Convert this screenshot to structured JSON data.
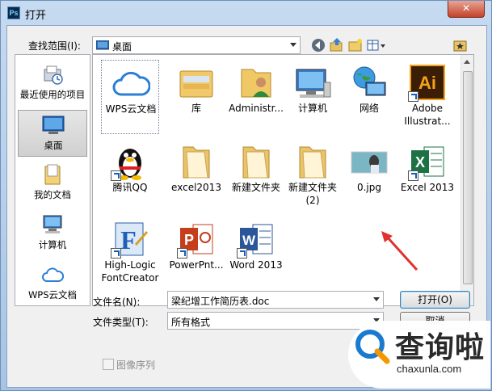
{
  "window": {
    "app_icon_text": "Ps",
    "title": "打开",
    "close_glyph": "✕"
  },
  "lookin": {
    "label": "查找范围(I):",
    "value": "桌面"
  },
  "places": [
    {
      "label": "最近使用的项目",
      "icon": "recent-places-icon"
    },
    {
      "label": "桌面",
      "icon": "desktop-icon",
      "selected": true
    },
    {
      "label": "我的文档",
      "icon": "my-documents-icon"
    },
    {
      "label": "计算机",
      "icon": "computer-icon"
    },
    {
      "label": "WPS云文档",
      "icon": "wps-cloud-icon"
    }
  ],
  "files": [
    {
      "name": "WPS云文档",
      "icon": "wps-cloud-icon",
      "selected": true
    },
    {
      "name": "库",
      "icon": "library-folder-icon"
    },
    {
      "name": "Administr...",
      "icon": "user-folder-icon"
    },
    {
      "name": "计算机",
      "icon": "computer-icon"
    },
    {
      "name": "网络",
      "icon": "network-icon"
    },
    {
      "name": "Adobe Illustrat...",
      "icon": "adobe-illustrator-icon",
      "shortcut": true
    },
    {
      "name": "腾讯QQ",
      "icon": "qq-penguin-icon",
      "shortcut": true
    },
    {
      "name": "excel2013",
      "icon": "folder-icon"
    },
    {
      "name": "新建文件夹",
      "icon": "folder-icon"
    },
    {
      "name": "新建文件夹 (2)",
      "icon": "folder-icon"
    },
    {
      "name": "0.jpg",
      "icon": "image-thumbnail-icon"
    },
    {
      "name": "Excel 2013",
      "icon": "excel-icon",
      "shortcut": true
    },
    {
      "name": "High-Logic FontCreator",
      "icon": "fontcreator-icon",
      "shortcut": true
    },
    {
      "name": "PowerPnt...",
      "icon": "powerpoint-icon",
      "shortcut": true
    },
    {
      "name": "Word 2013",
      "icon": "word-icon",
      "shortcut": true
    }
  ],
  "filename": {
    "label": "文件名(N):",
    "value": "梁纪增工作简历表.doc"
  },
  "filetype": {
    "label": "文件类型(T):",
    "value": "所有格式"
  },
  "buttons": {
    "open": "打开(O)",
    "cancel": "取消"
  },
  "image_sequence": {
    "label": "图像序列",
    "checked": false
  },
  "watermark": {
    "text": "查询啦",
    "url": "chaxunla.com"
  },
  "colors": {
    "accent": "#1e73be",
    "annotation": "#e0322e",
    "wm_blue": "#1a7ad0",
    "wm_orange": "#f39800"
  }
}
